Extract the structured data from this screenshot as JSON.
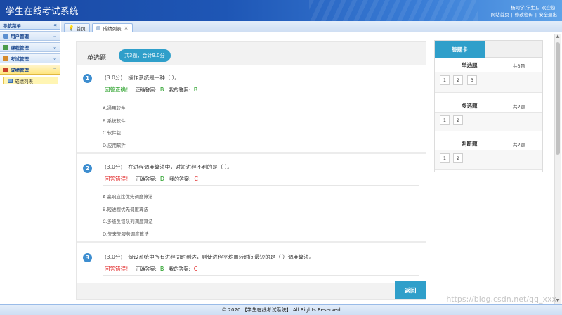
{
  "header": {
    "app_title": "学生在线考试系统",
    "greeting": "杨同学[学生]，欢迎您!",
    "links": [
      "网站首页",
      "修改密码",
      "安全退出"
    ]
  },
  "sidebar": {
    "title": "导航菜单",
    "collapse_icon": "double-chevron-left-icon",
    "items": [
      {
        "label": "用户管理",
        "icon": "users-icon",
        "expanded": false
      },
      {
        "label": "课程管理",
        "icon": "grid-icon",
        "expanded": false
      },
      {
        "label": "考试管理",
        "icon": "table-icon",
        "expanded": false
      },
      {
        "label": "成绩管理",
        "icon": "stats-icon",
        "expanded": true
      }
    ],
    "sub_items": [
      {
        "label": "成绩列表",
        "icon": "list-icon"
      }
    ]
  },
  "tabs": [
    {
      "label": "首页",
      "icon": "lightbulb-icon",
      "closable": false,
      "active": false
    },
    {
      "label": "成绩列表",
      "icon": "list-icon",
      "closable": true,
      "active": true
    }
  ],
  "section": {
    "title": "单选题",
    "summary": "共3题，合计9.0分"
  },
  "questions": [
    {
      "num": "1",
      "score": "(3.0分)",
      "text": "操作系统是一种（ ）。",
      "result": "回答正确！",
      "correct_label": "正确答案:",
      "correct_answer": "B",
      "my_label": "我的答案:",
      "my_answer": "B",
      "options": [
        "A.通用软件",
        "B.系统软件",
        "C.软件包",
        "D.应用软件"
      ]
    },
    {
      "num": "2",
      "score": "(3.0分)",
      "text": "在进程调度算法中，对短进程不利的是（ ）。",
      "result": "回答错误！",
      "correct_label": "正确答案:",
      "correct_answer": "D",
      "my_label": "我的答案:",
      "my_answer": "C",
      "options": [
        "A.高响应比优先调度算法",
        "B.短进程优先调度算法",
        "C.多级反馈队列调度算法",
        "D.先来先服务调度算法"
      ]
    },
    {
      "num": "3",
      "score": "(3.0分)",
      "text": "假设系统中所有进程同时到达，则使进程平均周转时间最短的是（ ）调度算法。",
      "result": "回答错误！",
      "correct_label": "正确答案:",
      "correct_answer": "B",
      "my_label": "我的答案:",
      "my_answer": "C",
      "options": []
    }
  ],
  "back_button": "返回",
  "answer_card": {
    "tab": "答题卡",
    "groups": [
      {
        "title": "单选题",
        "count": "共3题",
        "numbers": [
          "1",
          "2",
          "3"
        ]
      },
      {
        "title": "多选题",
        "count": "共2题",
        "numbers": [
          "1",
          "2"
        ]
      },
      {
        "title": "判断题",
        "count": "共2题",
        "numbers": [
          "1",
          "2"
        ]
      }
    ]
  },
  "footer": {
    "copyright": "© 2020 【学生在线考试系统】 All Rights Reserved"
  },
  "watermark": "https://blog.csdn.net/qq_xxx"
}
